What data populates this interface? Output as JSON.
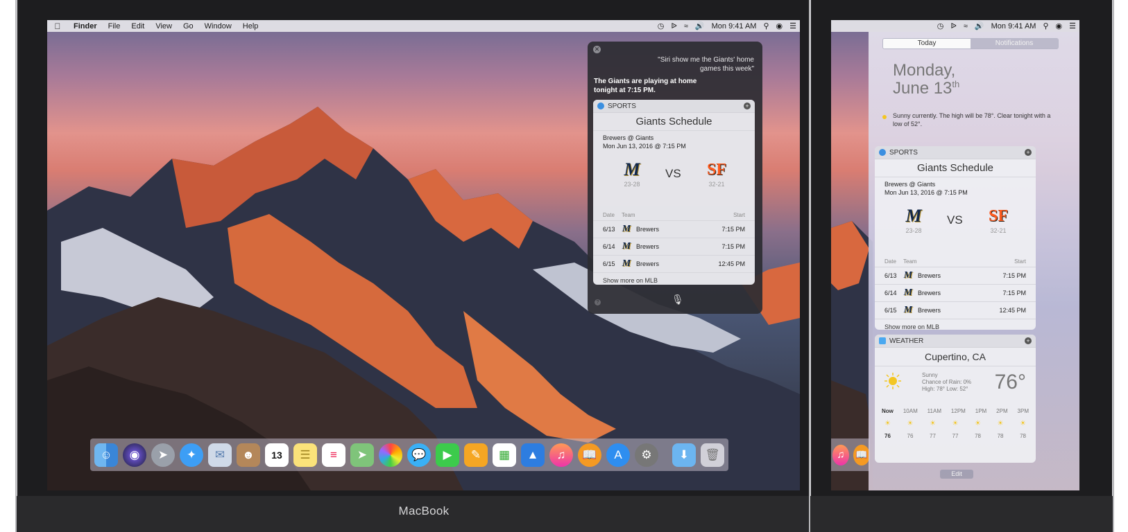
{
  "menubar": {
    "items": [
      "Finder",
      "File",
      "Edit",
      "View",
      "Go",
      "Window",
      "Help"
    ],
    "clock": "Mon 9:41 AM"
  },
  "siri": {
    "query": "\"Siri show me the Giants' home games this week\"",
    "answer": "The Giants are playing at home tonight at 7:15 PM."
  },
  "sports": {
    "section": "SPORTS",
    "title": "Giants Schedule",
    "matchup": "Brewers @ Giants",
    "datetime": "Mon Jun 13, 2016 @ 7:15 PM",
    "away_record": "23-28",
    "home_record": "32-21",
    "vs": "VS",
    "col_date": "Date",
    "col_team": "Team",
    "col_start": "Start",
    "rows": [
      {
        "date": "6/13",
        "team": "Brewers",
        "start": "7:15 PM"
      },
      {
        "date": "6/14",
        "team": "Brewers",
        "start": "7:15 PM"
      },
      {
        "date": "6/15",
        "team": "Brewers",
        "start": "12:45 PM"
      }
    ],
    "more": "Show more on MLB"
  },
  "nc": {
    "tab_today": "Today",
    "tab_notifications": "Notifications",
    "day": "Monday,",
    "date": "June 13",
    "date_suffix": "th",
    "forecast": "Sunny currently. The high will be 78°. Clear tonight with a low of 52°.",
    "edit": "Edit"
  },
  "weather": {
    "section": "WEATHER",
    "city": "Cupertino, CA",
    "condition": "Sunny",
    "rain": "Chance of Rain: 0%",
    "hilo": "High: 78°  Low: 52°",
    "temp": "76°",
    "hours": [
      "Now",
      "10AM",
      "11AM",
      "12PM",
      "1PM",
      "2PM",
      "3PM"
    ],
    "temps": [
      "76",
      "76",
      "77",
      "77",
      "78",
      "78",
      "78"
    ]
  },
  "device": {
    "brand": "MacBook"
  },
  "dock": {
    "calendar_day": "13",
    "apps": [
      "finder",
      "siri",
      "launchpad",
      "safari",
      "mail",
      "contacts",
      "calendar",
      "notes",
      "reminders",
      "maps",
      "photos",
      "messages",
      "facetime",
      "pages",
      "numbers",
      "keynote",
      "itunes",
      "ibooks",
      "app-store",
      "system-preferences",
      "downloads",
      "trash"
    ]
  },
  "colors": {
    "accent": "#3b8fe0",
    "brewers_navy": "#12284b",
    "giants_orange": "#fd5a1e",
    "sun": "#f3c623"
  }
}
